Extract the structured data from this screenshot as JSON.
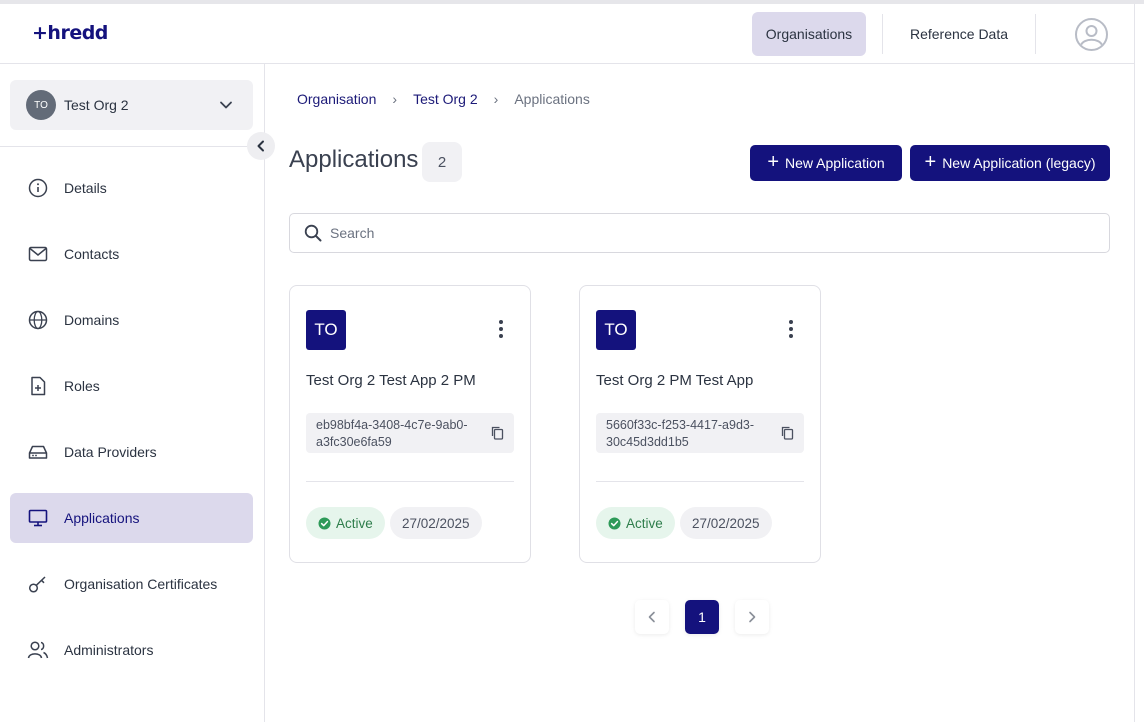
{
  "brand": {
    "logo_text": "+hredd",
    "accent": "#14127d"
  },
  "header": {
    "nav": [
      {
        "label": "Organisations",
        "active": true
      },
      {
        "label": "Reference Data",
        "active": false
      }
    ],
    "user_icon": "user-circle-icon"
  },
  "sidebar": {
    "org": {
      "initials": "TO",
      "name": "Test Org 2"
    },
    "items": [
      {
        "label": "Details",
        "icon": "info-icon",
        "active": false
      },
      {
        "label": "Contacts",
        "icon": "mail-icon",
        "active": false
      },
      {
        "label": "Domains",
        "icon": "globe-icon",
        "active": false
      },
      {
        "label": "Roles",
        "icon": "file-plus-icon",
        "active": false
      },
      {
        "label": "Data Providers",
        "icon": "hard-drive-icon",
        "active": false
      },
      {
        "label": "Applications",
        "icon": "monitor-icon",
        "active": true
      },
      {
        "label": "Organisation Certificates",
        "icon": "key-icon",
        "active": false
      },
      {
        "label": "Administrators",
        "icon": "users-icon",
        "active": false
      }
    ]
  },
  "breadcrumb": [
    {
      "label": "Organisation"
    },
    {
      "label": "Test Org 2"
    },
    {
      "label": "Applications"
    }
  ],
  "page": {
    "title": "Applications",
    "count": "2",
    "new_button": "New Application",
    "legacy_button": "New Application (legacy)"
  },
  "search": {
    "placeholder": "Search",
    "value": ""
  },
  "applications": [
    {
      "initials": "TO",
      "name": "Test Org 2 Test App 2 PM",
      "id_line1": "eb98bf4a-3408-4c7e-9ab0-",
      "id_line2": "a3fc30e6fa59",
      "status": "Active",
      "date": "27/02/2025"
    },
    {
      "initials": "TO",
      "name": "Test Org 2 PM Test App",
      "id_line1": "5660f33c-f253-4417-a9d3-",
      "id_line2": "30c45d3dd1b5",
      "status": "Active",
      "date": "27/02/2025"
    }
  ],
  "pagination": {
    "current": "1"
  }
}
